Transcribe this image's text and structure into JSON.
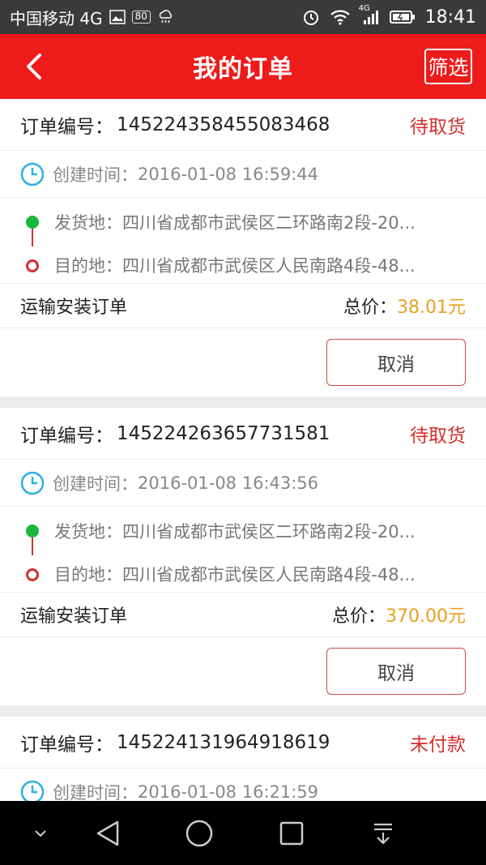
{
  "status_bar": {
    "carrier": "中国移动 4G",
    "badge": "80",
    "network": "4G",
    "time": "18:41"
  },
  "header": {
    "title": "我的订单",
    "filter_label": "筛选"
  },
  "labels": {
    "order_no": "订单编号：",
    "created": "创建时间：",
    "from": "发货地：",
    "to": "目的地：",
    "total": "总价："
  },
  "orders": [
    {
      "order_no": "145224358455083468",
      "status": "待取货",
      "created_time": "2016-01-08 16:59:44",
      "from": "四川省成都市武侯区二环路南2段-20...",
      "to": "四川省成都市武侯区人民南路4段-48...",
      "type": "运输安装订单",
      "price": "38.01元",
      "action": "取消"
    },
    {
      "order_no": "145224263657731581",
      "status": "待取货",
      "created_time": "2016-01-08 16:43:56",
      "from": "四川省成都市武侯区二环路南2段-20...",
      "to": "四川省成都市武侯区人民南路4段-48...",
      "type": "运输安装订单",
      "price": "370.00元",
      "action": "取消"
    },
    {
      "order_no": "145224131964918619",
      "status": "未付款",
      "created_time": "2016-01-08 16:21:59"
    }
  ],
  "colors": {
    "header_bg": "#ee1b1b",
    "status_red": "#d6302c",
    "price_orange": "#e8a020",
    "clock_blue": "#2bb1e6",
    "from_green": "#19b83d"
  }
}
